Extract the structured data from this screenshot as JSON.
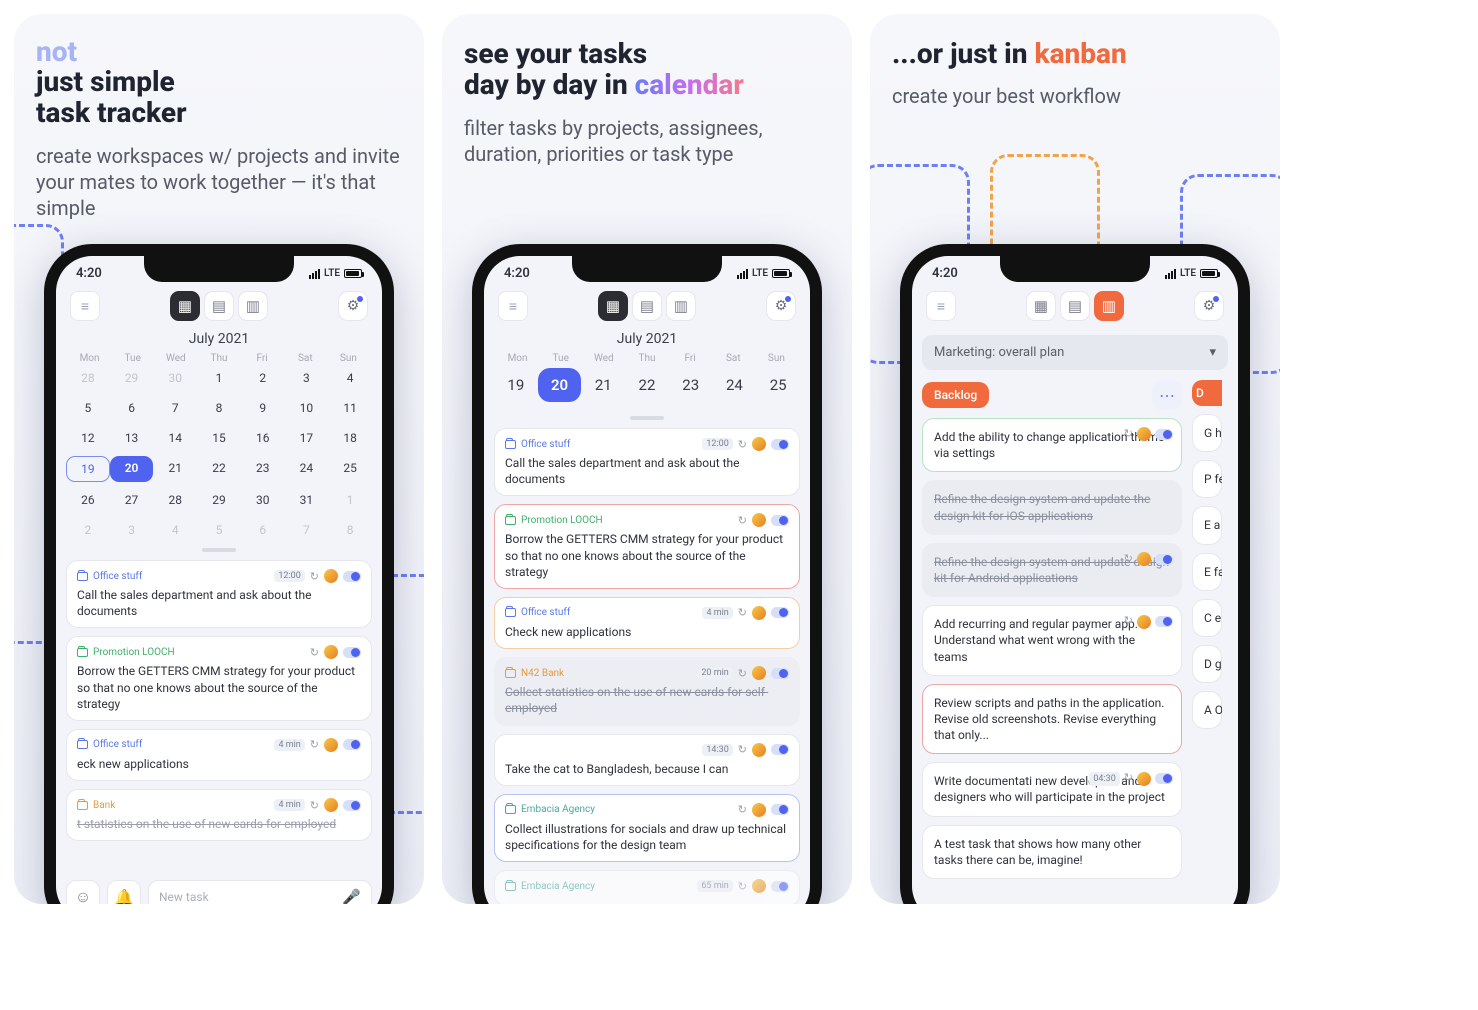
{
  "status": {
    "time": "4:20",
    "net": "LTE"
  },
  "panel1": {
    "not": "not",
    "title1": "just simple",
    "title2": "task tracker",
    "sub": "create workspaces w/ projects and invite your mates to work together — it's that simple"
  },
  "panel2": {
    "title1": "see your tasks",
    "title2a": "day by day in ",
    "title2b": "calendar",
    "sub": "filter tasks by projects, assignees, duration, priorities or task type"
  },
  "panel3": {
    "title_a": "...or just in ",
    "title_b": "kanban",
    "sub": "create your best workflow"
  },
  "calendar": {
    "month": "July 2021",
    "dow": [
      "Mon",
      "Tue",
      "Wed",
      "Thu",
      "Fri",
      "Sat",
      "Sun"
    ],
    "grid": [
      [
        {
          "n": "28",
          "dim": true
        },
        {
          "n": "29",
          "dim": true
        },
        {
          "n": "30",
          "dim": true
        },
        {
          "n": "1"
        },
        {
          "n": "2"
        },
        {
          "n": "3"
        },
        {
          "n": "4"
        }
      ],
      [
        {
          "n": "5"
        },
        {
          "n": "6"
        },
        {
          "n": "7"
        },
        {
          "n": "8"
        },
        {
          "n": "9"
        },
        {
          "n": "10"
        },
        {
          "n": "11"
        }
      ],
      [
        {
          "n": "12"
        },
        {
          "n": "13"
        },
        {
          "n": "14"
        },
        {
          "n": "15"
        },
        {
          "n": "16"
        },
        {
          "n": "17"
        },
        {
          "n": "18"
        }
      ],
      [
        {
          "n": "19",
          "outline": true
        },
        {
          "n": "20",
          "today": true
        },
        {
          "n": "21"
        },
        {
          "n": "22"
        },
        {
          "n": "23"
        },
        {
          "n": "24"
        },
        {
          "n": "25"
        }
      ],
      [
        {
          "n": "26"
        },
        {
          "n": "27"
        },
        {
          "n": "28"
        },
        {
          "n": "29"
        },
        {
          "n": "30"
        },
        {
          "n": "31"
        },
        {
          "n": "1",
          "dim": true
        }
      ],
      [
        {
          "n": "2",
          "dim": true
        },
        {
          "n": "3",
          "dim": true
        },
        {
          "n": "4",
          "dim": true
        },
        {
          "n": "5",
          "dim": true
        },
        {
          "n": "6",
          "dim": true
        },
        {
          "n": "7",
          "dim": true
        },
        {
          "n": "8",
          "dim": true
        }
      ]
    ],
    "row": [
      "19",
      "20",
      "21",
      "22",
      "23",
      "24",
      "25"
    ]
  },
  "tasks1": [
    {
      "proj": "Office stuff",
      "projColor": "blue",
      "time": "12:00",
      "text": "Call the sales department and ask about the documents"
    },
    {
      "proj": "Promotion LOOCH",
      "projColor": "green",
      "time": "",
      "text": "Borrow the GETTERS CMM strategy for your product so that no one knows about the source of the strategy"
    },
    {
      "proj": "Office stuff",
      "projColor": "blue",
      "time": "4 min",
      "text": "eck new applications",
      "partial": true
    },
    {
      "proj": "Bank",
      "projColor": "orange",
      "time": "4 min",
      "text": "t statistics on the use of new cards for employed",
      "partial": true,
      "done": true
    }
  ],
  "tasks2": [
    {
      "proj": "Office stuff",
      "projColor": "blue",
      "time": "12:00",
      "text": "Call the sales department and ask about the documents",
      "border": "plain"
    },
    {
      "proj": "Promotion LOOCH",
      "projColor": "green",
      "time": "",
      "text": "Borrow the GETTERS CMM strategy for your product so that no one knows about the source of the strategy",
      "border": "red"
    },
    {
      "proj": "Office stuff",
      "projColor": "blue",
      "time": "4 min",
      "text": "Check new applications",
      "border": "orange"
    },
    {
      "proj": "N42 Bank",
      "projColor": "orange",
      "time": "20 min",
      "text": "Collect statistics on the use of new cards for self-employed",
      "border": "grey",
      "done": true
    },
    {
      "proj": "",
      "projColor": "",
      "time": "14:30",
      "text": "Take the cat to Bangladesh, because I can",
      "border": "plain"
    },
    {
      "proj": "Embacia Agency",
      "projColor": "teal",
      "time": "",
      "text": "Collect illustrations for socials and draw up technical specifications for the design team",
      "border": "blue"
    },
    {
      "proj": "Embacia Agency",
      "projColor": "teal",
      "time": "65 min",
      "text": "",
      "border": "plain",
      "peek": true
    }
  ],
  "newtask_placeholder": "New task",
  "kanban": {
    "board": "Marketing: overall plan",
    "col1": "Backlog",
    "col2_initial": "D",
    "cards": [
      {
        "text": "Add the ability to change application theme via settings",
        "border": "green",
        "badges": true
      },
      {
        "text": "Refine the design system and update the design kit for iOS applications",
        "border": "grey",
        "done": true
      },
      {
        "text": "Refine the design system and update design kit for Android applications",
        "border": "grey",
        "done": true,
        "badges": true
      },
      {
        "text": "Add recurring and regular paymer app. Understand what went wrong with the teams",
        "border": "plain",
        "badges": true
      },
      {
        "text": "Review scripts and paths in the application. Revise old screenshots. Revise everything that only...",
        "border": "red"
      },
      {
        "text": "Write documentati new developers and designers who will participate in the project",
        "border": "plain",
        "meta": "04:30",
        "badges": true
      },
      {
        "text": "A test task that shows how many other tasks there can be, imagine!",
        "border": "plain"
      }
    ],
    "peek": [
      {
        "t": "G h a"
      },
      {
        "t": "P fe"
      },
      {
        "t": "E a se"
      },
      {
        "t": "E fa e"
      },
      {
        "t": "C e d"
      },
      {
        "t": "D g m"
      },
      {
        "t": "A O s"
      }
    ]
  }
}
